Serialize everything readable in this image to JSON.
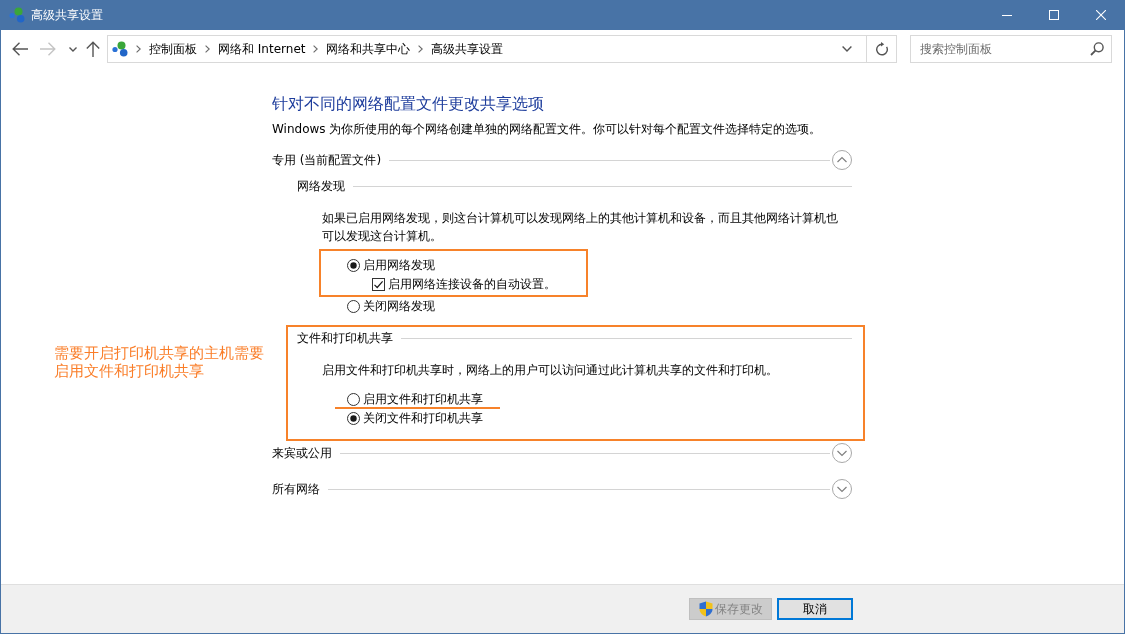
{
  "window": {
    "title": "高级共享设置"
  },
  "navigation": {
    "buttons": [
      {
        "kind": "back",
        "disabled": false
      },
      {
        "kind": "forward",
        "disabled": true
      },
      {
        "kind": "recent",
        "disabled": false
      },
      {
        "kind": "up",
        "disabled": false
      }
    ],
    "breadcrumb": [
      "控制面板",
      "网络和 Internet",
      "网络和共享中心",
      "高级共享设置"
    ],
    "search": {
      "placeholder": "搜索控制面板"
    }
  },
  "page": {
    "heading": "针对不同的网络配置文件更改共享选项",
    "intro": "Windows 为你所使用的每个网络创建单独的网络配置文件。你可以针对每个配置文件选择特定的选项。"
  },
  "profiles": [
    {
      "title": "专用 (当前配置文件)",
      "expanded": true,
      "sections": [
        {
          "title": "网络发现",
          "highlighted": false,
          "description": "如果已启用网络发现，则这台计算机可以发现网络上的其他计算机和设备，而且其他网络计算机也可以发现这台计算机。",
          "options": [
            {
              "kind": "radio",
              "label": "启用网络发现",
              "selected": true,
              "highlighted": true,
              "underlined": false,
              "children": [
                {
                  "kind": "checkbox",
                  "label": "启用网络连接设备的自动设置。",
                  "checked": true
                }
              ]
            },
            {
              "kind": "radio",
              "label": "关闭网络发现",
              "selected": false,
              "highlighted": false,
              "underlined": false
            }
          ]
        },
        {
          "title": "文件和打印机共享",
          "highlighted": true,
          "description": "启用文件和打印机共享时，网络上的用户可以访问通过此计算机共享的文件和打印机。",
          "options": [
            {
              "kind": "radio",
              "label": "启用文件和打印机共享",
              "selected": false,
              "highlighted": false,
              "underlined": true
            },
            {
              "kind": "radio",
              "label": "关闭文件和打印机共享",
              "selected": true,
              "highlighted": false,
              "underlined": false
            }
          ]
        }
      ]
    },
    {
      "title": "来宾或公用",
      "expanded": false
    },
    {
      "title": "所有网络",
      "expanded": false
    }
  ],
  "annotation": {
    "text": "需要开启打印机共享的主机需要启用文件和打印机共享"
  },
  "buttons": [
    {
      "label": "保存更改",
      "kind": "elevated",
      "disabled": true,
      "default": false
    },
    {
      "label": "取消",
      "kind": "plain",
      "disabled": false,
      "default": true
    }
  ]
}
